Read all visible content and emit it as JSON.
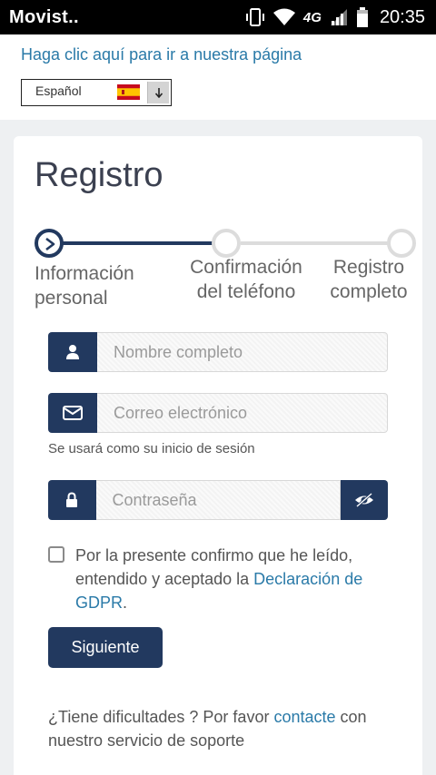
{
  "status_bar": {
    "carrier": "Movist..",
    "network": "4G",
    "time": "20:35"
  },
  "top": {
    "home_link": "Haga clic aquí para ir a nuestra página",
    "language": {
      "selected": "Español",
      "flag": "spain-flag-icon",
      "arrow_icon": "arrow-down-icon"
    }
  },
  "form": {
    "title": "Registro",
    "steps": [
      {
        "label": "Información personal",
        "state": "active"
      },
      {
        "label": "Confirmación del teléfono",
        "state": "pending"
      },
      {
        "label": "Registro completo",
        "state": "pending"
      }
    ],
    "name_field": {
      "placeholder": "Nombre completo",
      "icon": "user-icon",
      "value": ""
    },
    "email_field": {
      "placeholder": "Correo electrónico",
      "icon": "envelope-icon",
      "value": ""
    },
    "email_hint": "Se usará como su inicio de sesión",
    "password_field": {
      "placeholder": "Contraseña",
      "icon": "lock-icon",
      "toggle_icon": "eye-slash-icon",
      "value": ""
    },
    "consent": {
      "checked": false,
      "text": "Por la presente confirmo que he leído, entendido y aceptado la ",
      "link_text": "Declaración de GDPR",
      "suffix": "."
    },
    "next_button": "Siguiente",
    "support": {
      "prefix": "¿Tiene dificultades ? Por favor ",
      "link_text": "contacte",
      "suffix": " con nuestro servicio de soporte"
    }
  },
  "colors": {
    "primary": "#22395f",
    "link": "#2a7aa8",
    "background": "#eef0f2",
    "step_idle": "#dcdcdc"
  }
}
